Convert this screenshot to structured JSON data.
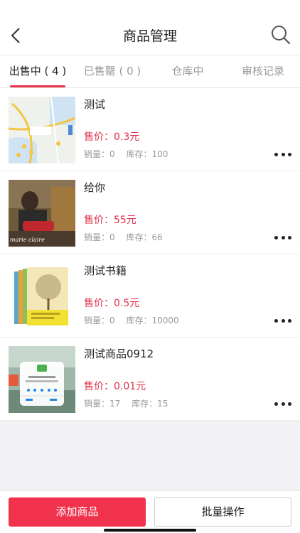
{
  "header": {
    "title": "商品管理",
    "back_icon": "chevron-left-icon",
    "search_icon": "search-icon"
  },
  "tabs": [
    {
      "label": "出售中 ( 4 )",
      "active": true
    },
    {
      "label": "已售罄 ( 0 )",
      "active": false
    },
    {
      "label": "仓库中",
      "active": false
    },
    {
      "label": "审核记录",
      "active": false
    }
  ],
  "products": [
    {
      "name": "测试",
      "price": "售价：0.3元",
      "sales": "销量：0",
      "stock": "库存：100",
      "thumb_kind": "map"
    },
    {
      "name": "给你",
      "price": "售价：55元",
      "sales": "销量：0",
      "stock": "库存：66",
      "thumb_kind": "photo",
      "thumb_caption": "marie claire"
    },
    {
      "name": "测试书籍",
      "price": "售价：0.5元",
      "sales": "销量：0",
      "stock": "库存：10000",
      "thumb_kind": "books"
    },
    {
      "name": "测试商品0912",
      "price": "售价：0.01元",
      "sales": "销量：17",
      "stock": "库存：15",
      "thumb_kind": "app-screenshot"
    }
  ],
  "footer": {
    "add_label": "添加商品",
    "batch_label": "批量操作"
  },
  "colors": {
    "accent": "#f1324d",
    "price": "#e0304a"
  }
}
